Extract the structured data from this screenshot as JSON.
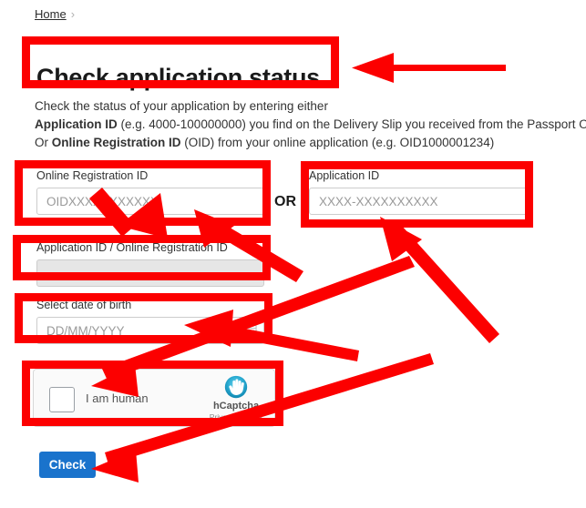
{
  "breadcrumb": {
    "home_label": "Home",
    "separator": "›"
  },
  "page_title": "Check application status",
  "description": {
    "line1": "Check the status of your application by entering either",
    "line2_bold": "Application ID",
    "line2_rest": " (e.g. 4000-100000000) you find on the Delivery Slip you received from the Passport Office",
    "line3_pre": "Or ",
    "line3_bold": "Online Registration ID",
    "line3_rest": " (OID) from your online application (e.g. OID1000001234)"
  },
  "form": {
    "online_registration_id": {
      "label": "Online Registration ID",
      "placeholder": "OIDXXXXXXXXXXX",
      "value": ""
    },
    "or_separator": "OR",
    "application_id": {
      "label": "Application ID",
      "placeholder": "XXXX-XXXXXXXXXX",
      "value": ""
    },
    "combined_id": {
      "label": "Application ID / Online Registration ID",
      "placeholder": "",
      "value": ""
    },
    "date_of_birth": {
      "label": "Select date of birth",
      "placeholder": "DD/MM/YYYY",
      "value": "",
      "icon": "calendar-icon"
    }
  },
  "captcha": {
    "checkbox_label": "I am human",
    "brand_name": "hCaptcha",
    "terms_text": "Privacy - Terms",
    "logo_icon": "hcaptcha-hand-icon"
  },
  "actions": {
    "check_label": "Check"
  },
  "annotations": {
    "highlight_color": "#fc0000",
    "boxes": [
      "page-title",
      "online-registration-id-field",
      "application-id-field",
      "combined-id-field",
      "date-of-birth-field",
      "captcha-widget"
    ],
    "arrow_count": 7
  },
  "colors": {
    "accent_button": "#1a73cc",
    "annotation_red": "#fc0000",
    "text": "#333333"
  }
}
